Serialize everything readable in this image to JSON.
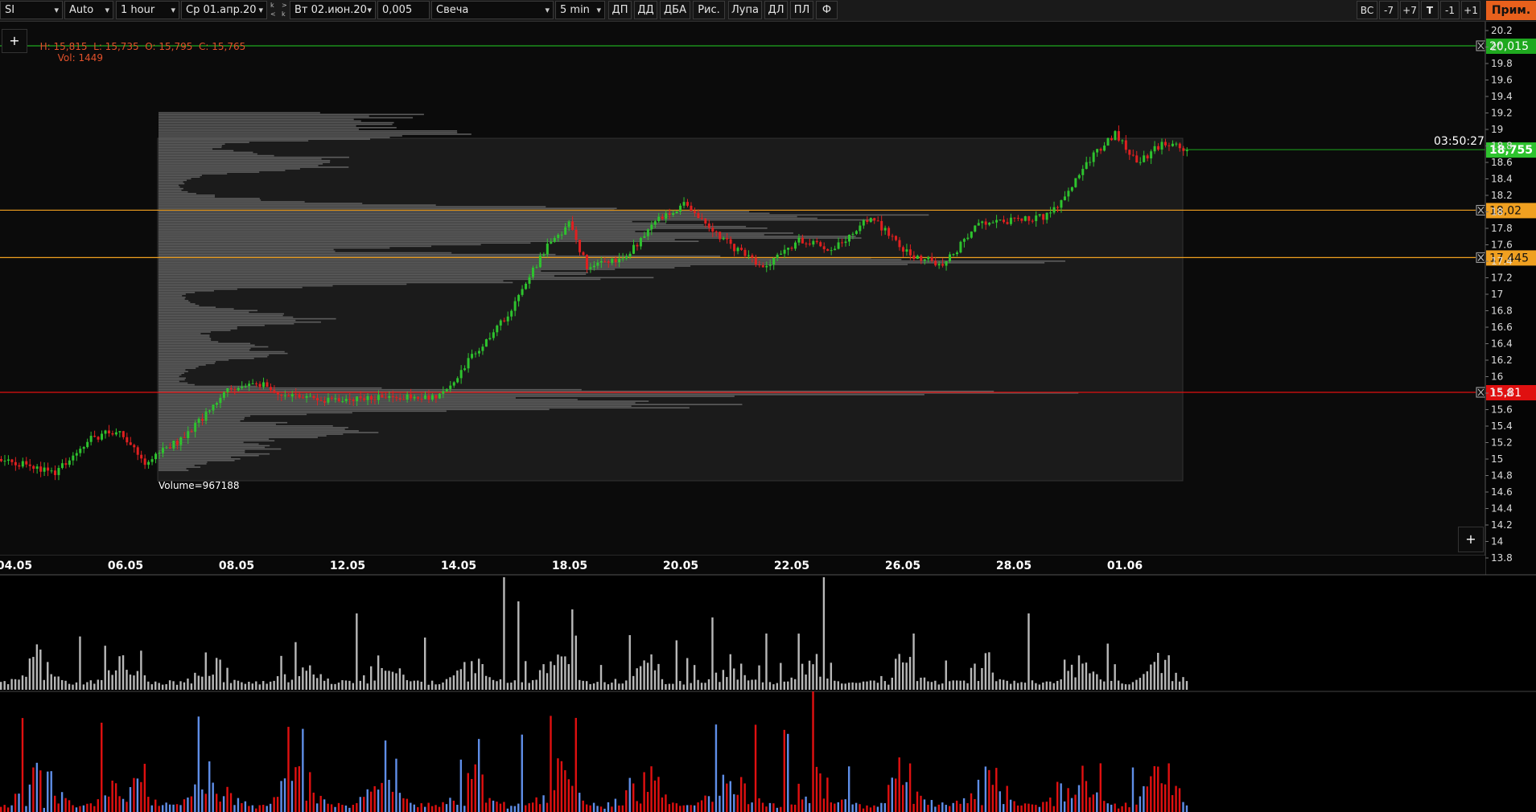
{
  "toolbar": {
    "symbol": "SI",
    "scale_mode": "Auto",
    "timeframe": "1 hour",
    "date_from": "Ср 01.апр.20",
    "date_to": "Вт 02.июн.20",
    "nav_k1": "k",
    "nav_k2": "k",
    "nav_prev": "<",
    "nav_next": ">",
    "step": "0,005",
    "chart_type": "Свеча",
    "update": "5 min",
    "buttons": [
      "ДП",
      "ДД",
      "ДБА",
      "Рис.",
      "Лупа",
      "ДЛ",
      "ПЛ",
      "Ф"
    ],
    "right_buttons": [
      "ВС",
      "-7",
      "+7",
      "T",
      "-1",
      "+1"
    ],
    "prim_label": "Прим."
  },
  "info_line": {
    "ohlc": "H: 15,815  L: 15,735  O: 15,795  C: 15,765",
    "volume": "Vol: 1449",
    "ohlc_color": "#e0502a"
  },
  "plus_label": "+",
  "timer": "03:50:27",
  "volume_profile_label": "Volume=967188",
  "colors": {
    "up": "#2ec32e",
    "down": "#e02020",
    "level_orange": "#f0a020",
    "level_green": "#1fa81f",
    "level_red": "#e01010",
    "volume_gray": "#b8b8b8",
    "delta_red": "#e01010",
    "delta_blue": "#5f8ee8"
  },
  "levels": [
    {
      "label": "20,015",
      "price": 20.015,
      "color": "#1fa81f"
    },
    {
      "label": "18,02",
      "price": 18.02,
      "color": "#f0a020"
    },
    {
      "label": "17,445",
      "price": 17.445,
      "color": "#f0a020"
    },
    {
      "label": "15,81",
      "price": 15.81,
      "color": "#e01010"
    }
  ],
  "last_price": {
    "label": "18,755",
    "price": 18.755,
    "color": "#2ec32e"
  },
  "chart_data": {
    "type": "candlestick",
    "x_tick_labels": [
      "04.05",
      "06.05",
      "08.05",
      "12.05",
      "14.05",
      "18.05",
      "20.05",
      "22.05",
      "26.05",
      "28.05",
      "01.06"
    ],
    "y_tick_labels": [
      "20.2",
      "20",
      "19.8",
      "19.6",
      "19.4",
      "19.2",
      "19",
      "18.8",
      "18.6",
      "18.4",
      "18.2",
      "18",
      "17.8",
      "17.6",
      "17.4",
      "17.2",
      "17",
      "16.8",
      "16.6",
      "16.4",
      "16.2",
      "16",
      "15.8",
      "15.6",
      "15.4",
      "15.2",
      "15",
      "14.8",
      "14.6",
      "14.4",
      "14.2",
      "14",
      "13.8"
    ],
    "ylim": [
      13.8,
      20.2
    ],
    "price_path": [
      {
        "bar": 0,
        "price": 15.0
      },
      {
        "bar": 15,
        "price": 14.85
      },
      {
        "bar": 25,
        "price": 15.25
      },
      {
        "bar": 32,
        "price": 15.35
      },
      {
        "bar": 40,
        "price": 14.95
      },
      {
        "bar": 52,
        "price": 15.3
      },
      {
        "bar": 62,
        "price": 15.8
      },
      {
        "bar": 70,
        "price": 15.95
      },
      {
        "bar": 80,
        "price": 15.75
      },
      {
        "bar": 95,
        "price": 15.7
      },
      {
        "bar": 110,
        "price": 15.75
      },
      {
        "bar": 122,
        "price": 15.75
      },
      {
        "bar": 132,
        "price": 16.3
      },
      {
        "bar": 142,
        "price": 16.8
      },
      {
        "bar": 152,
        "price": 17.6
      },
      {
        "bar": 158,
        "price": 17.85
      },
      {
        "bar": 163,
        "price": 17.35
      },
      {
        "bar": 174,
        "price": 17.45
      },
      {
        "bar": 182,
        "price": 17.9
      },
      {
        "bar": 190,
        "price": 18.1
      },
      {
        "bar": 200,
        "price": 17.7
      },
      {
        "bar": 212,
        "price": 17.3
      },
      {
        "bar": 222,
        "price": 17.65
      },
      {
        "bar": 232,
        "price": 17.55
      },
      {
        "bar": 242,
        "price": 17.95
      },
      {
        "bar": 252,
        "price": 17.5
      },
      {
        "bar": 262,
        "price": 17.35
      },
      {
        "bar": 272,
        "price": 17.85
      },
      {
        "bar": 282,
        "price": 17.9
      },
      {
        "bar": 292,
        "price": 17.95
      },
      {
        "bar": 302,
        "price": 18.6
      },
      {
        "bar": 310,
        "price": 18.95
      },
      {
        "bar": 316,
        "price": 18.6
      },
      {
        "bar": 324,
        "price": 18.85
      },
      {
        "bar": 330,
        "price": 18.75
      }
    ],
    "bar_count": 331
  }
}
